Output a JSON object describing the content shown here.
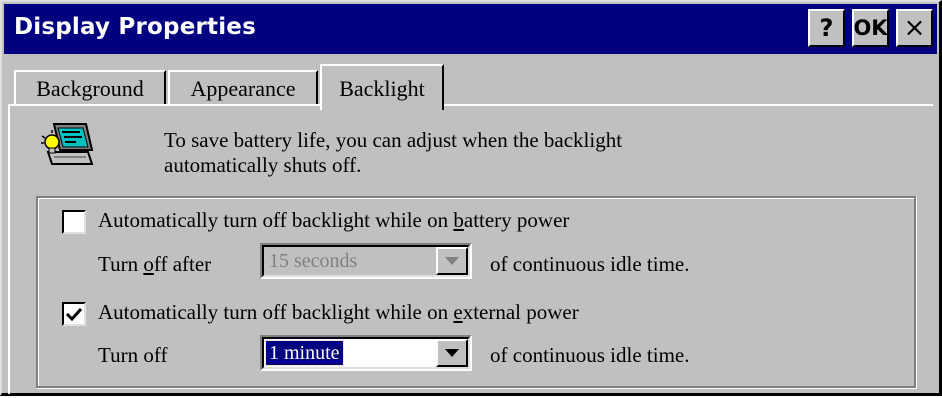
{
  "window": {
    "title": "Display Properties",
    "help_label": "?",
    "ok_label": "OK",
    "close_label": "×"
  },
  "tabs": [
    {
      "label": "Background",
      "selected": false
    },
    {
      "label": "Appearance",
      "selected": false
    },
    {
      "label": "Backlight",
      "selected": true
    }
  ],
  "content": {
    "description_line1": "To save battery life, you can adjust when the backlight",
    "description_line2": "automatically shuts off.",
    "battery": {
      "checkbox_label_pre": "Automatically turn off backlight while on ",
      "checkbox_label_hot": "b",
      "checkbox_label_post": "attery power",
      "checked": false,
      "turn_off_pre": "Turn ",
      "turn_off_hot": "o",
      "turn_off_post": "ff after",
      "value": "15 seconds",
      "suffix": "of continuous idle time."
    },
    "external": {
      "checkbox_label_pre": "Automatically turn off backlight while on ",
      "checkbox_label_hot": "e",
      "checkbox_label_post": "xternal power",
      "checked": true,
      "turn_off_label": "Turn off",
      "value": "1 minute",
      "suffix": "of continuous idle time."
    }
  },
  "colors": {
    "titlebar": "#000080",
    "face": "#c0c0c0",
    "selection": "#000080"
  }
}
